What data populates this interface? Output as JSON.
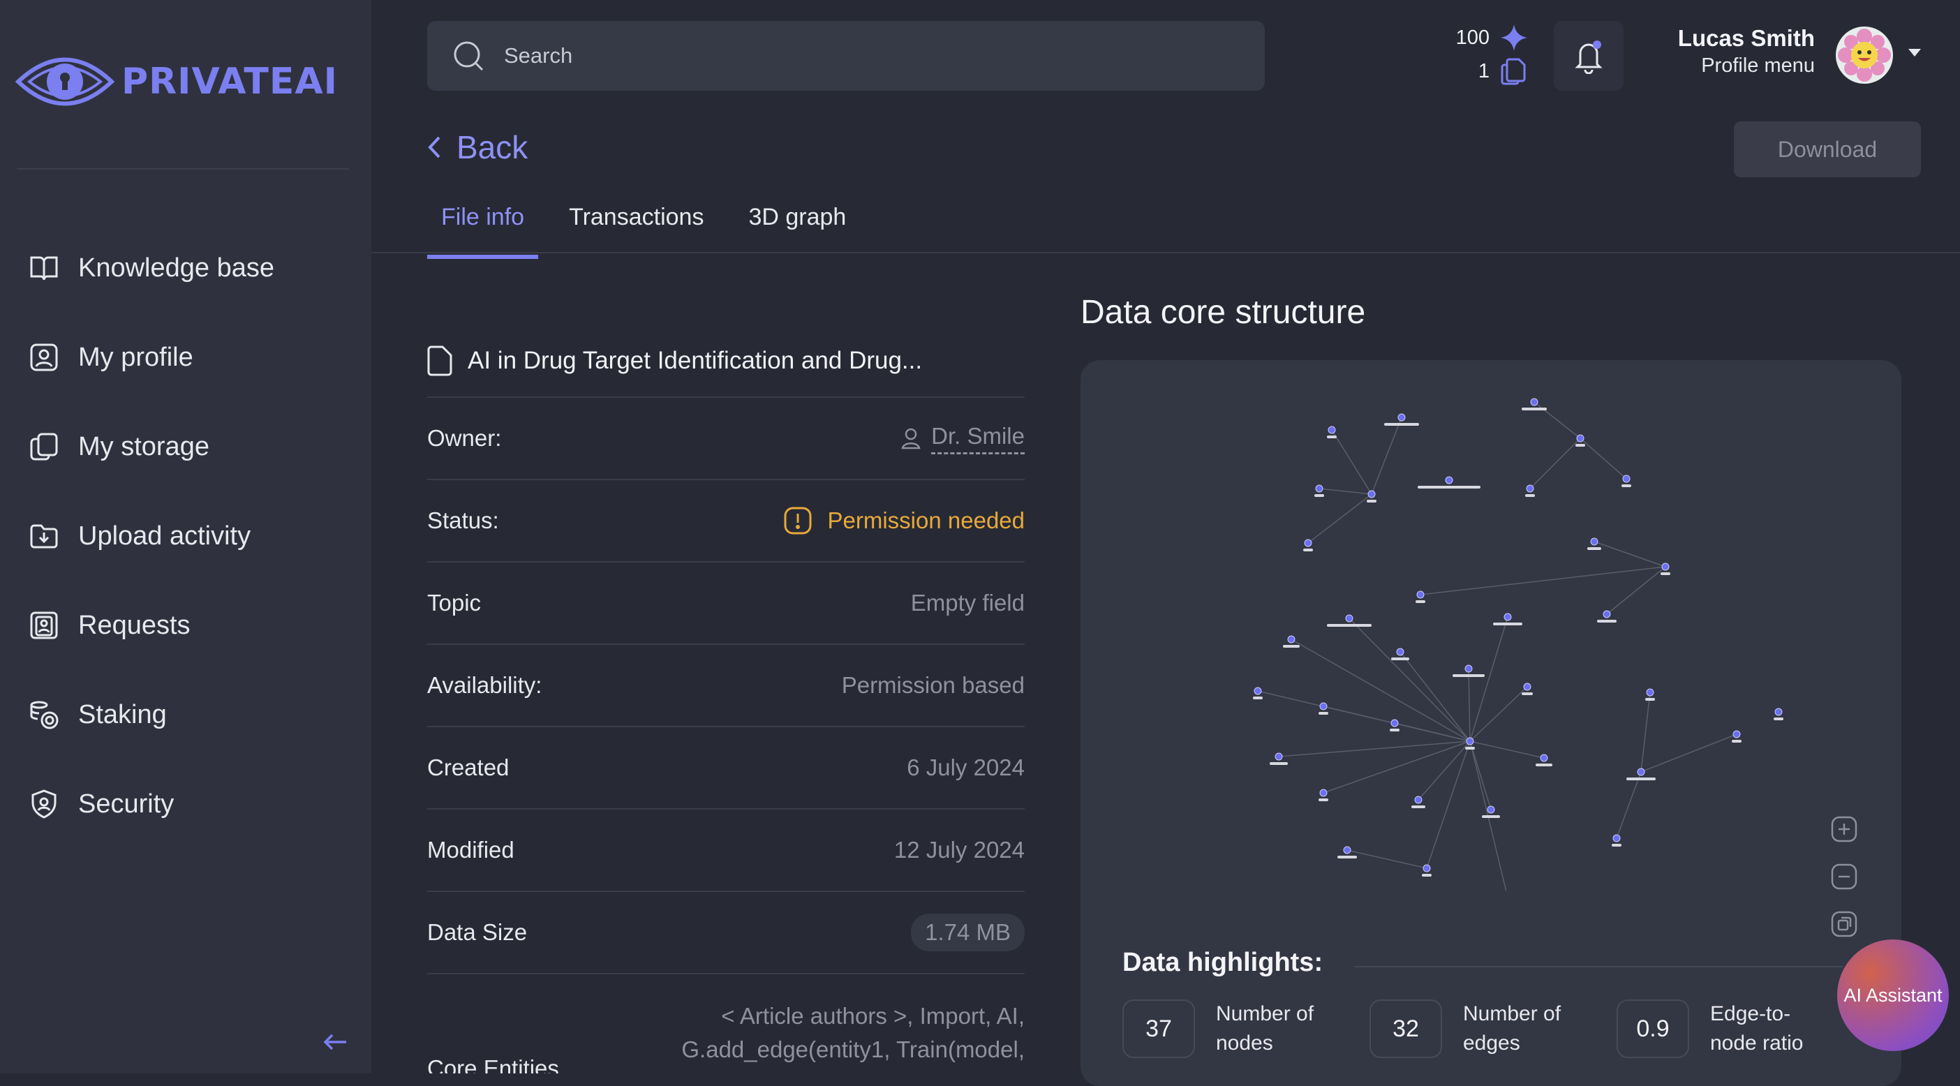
{
  "brand": {
    "name": "PRIVATEAI",
    "accent": "#7b7ff0"
  },
  "sidebar": {
    "items": [
      {
        "label": "Knowledge base",
        "icon": "book-icon"
      },
      {
        "label": "My profile",
        "icon": "user-card-icon"
      },
      {
        "label": "My storage",
        "icon": "copy-icon"
      },
      {
        "label": "Upload activity",
        "icon": "folder-upload-icon"
      },
      {
        "label": "Requests",
        "icon": "id-badge-icon"
      },
      {
        "label": "Staking",
        "icon": "coins-icon"
      },
      {
        "label": "Security",
        "icon": "shield-icon"
      }
    ],
    "collapse_icon": "arrow-left-icon"
  },
  "header": {
    "search_placeholder": "Search",
    "credits": {
      "points": "100",
      "files": "1"
    },
    "user": {
      "name": "Lucas Smith",
      "subtitle": "Profile menu"
    }
  },
  "page": {
    "back_label": "Back",
    "download_label": "Download",
    "tabs": [
      {
        "label": "File info",
        "active": true
      },
      {
        "label": "Transactions",
        "active": false
      },
      {
        "label": "3D graph",
        "active": false
      }
    ]
  },
  "file": {
    "title": "AI in Drug Target Identification and Drug...",
    "owner": {
      "label": "Owner:",
      "value": "Dr. Smile"
    },
    "status": {
      "label": "Status:",
      "value": "Permission needed",
      "color": "#e8a93a"
    },
    "topic": {
      "label": "Topic",
      "value": "Empty field"
    },
    "availability": {
      "label": "Availability:",
      "value": "Permission based"
    },
    "created": {
      "label": "Created",
      "value": "6 July 2024"
    },
    "modified": {
      "label": "Modified",
      "value": "12 July 2024"
    },
    "size": {
      "label": "Data Size",
      "value": "1.74 MB"
    },
    "entities": {
      "label": "Core Entities",
      "value": "< Article authors >, Import, AI, G.add_edge(entity1, Train(model,"
    }
  },
  "structure": {
    "title": "Data core structure",
    "highlights_title": "Data highlights:",
    "stats": [
      {
        "value": "37",
        "label": "Number of nodes"
      },
      {
        "value": "32",
        "label": "Number of edges"
      },
      {
        "value": "0.9",
        "label": "Edge-to-node ratio"
      }
    ]
  },
  "assistant": {
    "label": "AI Assistant"
  }
}
